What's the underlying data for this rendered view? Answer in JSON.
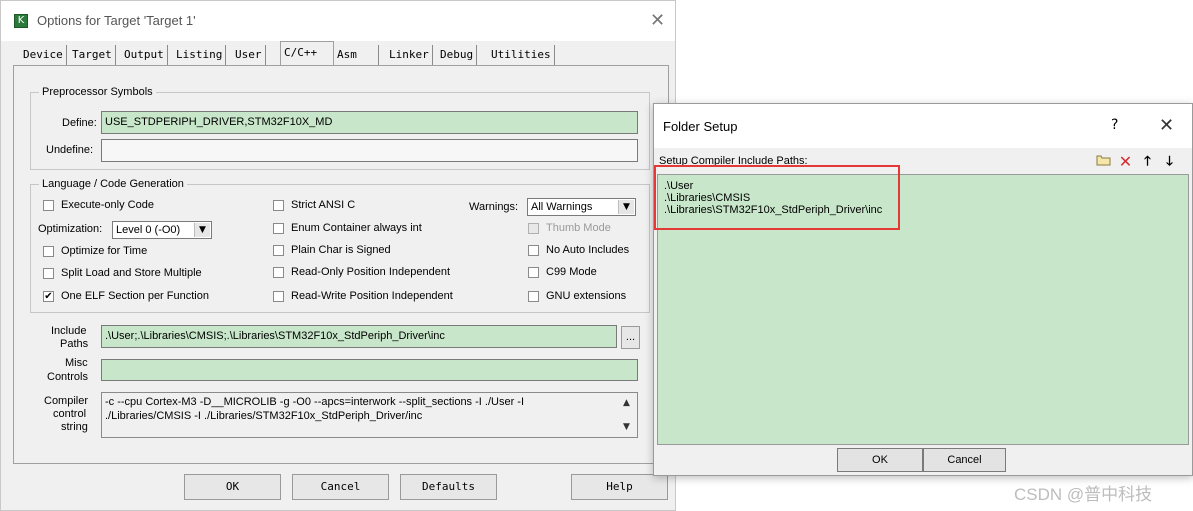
{
  "options_dialog": {
    "title": "Options for Target 'Target 1'",
    "app_icon": "keil-icon",
    "close_glyph": "✕",
    "tabs": [
      {
        "label": "Device"
      },
      {
        "label": "Target"
      },
      {
        "label": "Output"
      },
      {
        "label": "Listing"
      },
      {
        "label": "User"
      },
      {
        "label": "C/C++",
        "active": true
      },
      {
        "label": "Asm"
      },
      {
        "label": "Linker"
      },
      {
        "label": "Debug"
      },
      {
        "label": "Utilities"
      }
    ],
    "preprocessor": {
      "legend": "Preprocessor Symbols",
      "define_label": "Define:",
      "define_value": "USE_STDPERIPH_DRIVER,STM32F10X_MD",
      "undefine_label": "Undefine:",
      "undefine_value": ""
    },
    "codegen": {
      "legend": "Language / Code Generation",
      "execute_only": {
        "label": "Execute-only Code",
        "checked": false
      },
      "optimization_label": "Optimization:",
      "optimization_value": "Level 0 (-O0)",
      "optimize_time": {
        "label": "Optimize for Time",
        "checked": false
      },
      "split_load": {
        "label": "Split Load and Store Multiple",
        "checked": false
      },
      "one_elf": {
        "label": "One ELF Section per Function",
        "checked": true
      },
      "strict_ansi": {
        "label": "Strict ANSI C",
        "checked": false
      },
      "enum_container": {
        "label": "Enum Container always int",
        "checked": false
      },
      "plain_char": {
        "label": "Plain Char is Signed",
        "checked": false
      },
      "ro_pos": {
        "label": "Read-Only Position Independent",
        "checked": false
      },
      "rw_pos": {
        "label": "Read-Write Position Independent",
        "checked": false
      },
      "warnings_label": "Warnings:",
      "warnings_value": "All Warnings",
      "thumb_mode": {
        "label": "Thumb Mode",
        "checked": false,
        "disabled": true
      },
      "no_auto_includes": {
        "label": "No Auto Includes",
        "checked": false
      },
      "c99_mode": {
        "label": "C99 Mode",
        "checked": false
      },
      "gnu_ext": {
        "label": "GNU extensions",
        "checked": false
      }
    },
    "include_paths": {
      "label_line1": "Include",
      "label_line2": "Paths",
      "value": ".\\User;.\\Libraries\\CMSIS;.\\Libraries\\STM32F10x_StdPeriph_Driver\\inc",
      "browse_label": "..."
    },
    "misc_controls": {
      "label_line1": "Misc",
      "label_line2": "Controls",
      "value": ""
    },
    "compiler_string": {
      "label_line1": "Compiler",
      "label_line2": "control",
      "label_line3": "string",
      "line1": "-c --cpu Cortex-M3 -D__MICROLIB -g -O0 --apcs=interwork --split_sections -I ./User -I",
      "line2": "./Libraries/CMSIS -I ./Libraries/STM32F10x_StdPeriph_Driver/inc"
    },
    "buttons": {
      "ok": "OK",
      "cancel": "Cancel",
      "defaults": "Defaults",
      "help": "Help"
    }
  },
  "folder_setup": {
    "title": "Folder Setup",
    "help_glyph": "?",
    "close_glyph": "✕",
    "list_label": "Setup Compiler Include Paths:",
    "toolbar_icons": [
      "new-folder-icon",
      "delete-icon",
      "move-up-icon",
      "move-down-icon"
    ],
    "paths": [
      ".\\User",
      ".\\Libraries\\CMSIS",
      ".\\Libraries\\STM32F10x_StdPeriph_Driver\\inc"
    ],
    "ok_label": "OK",
    "cancel_label": "Cancel",
    "highlight_color": "#e53935",
    "list_bg": "#c8e6c9"
  },
  "watermark": "CSDN @普中科技"
}
